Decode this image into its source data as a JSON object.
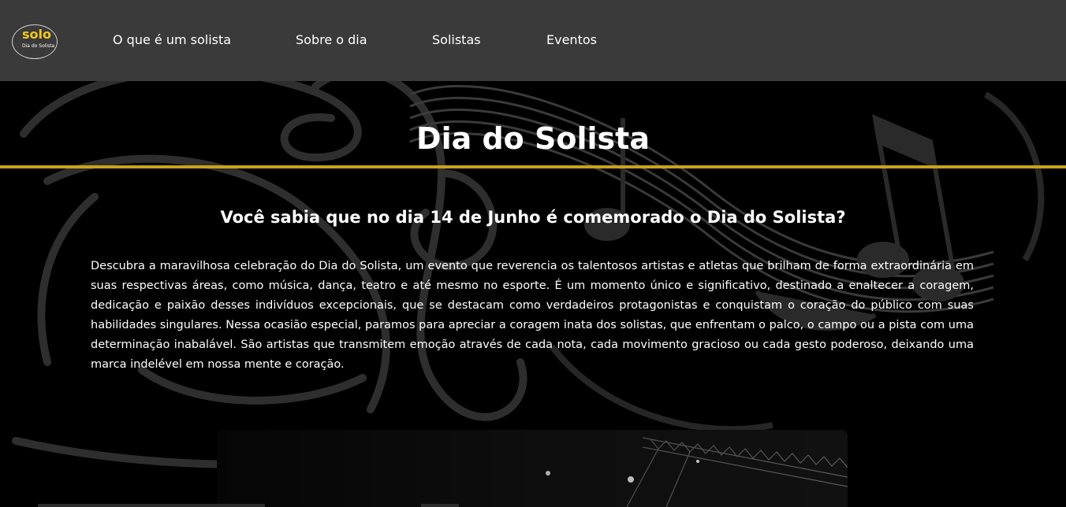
{
  "logo": {
    "word": "solo",
    "subtitle": "Dia do Solista"
  },
  "nav": {
    "items": [
      {
        "label": "O que é um solista"
      },
      {
        "label": "Sobre o dia"
      },
      {
        "label": "Solistas"
      },
      {
        "label": "Eventos"
      }
    ]
  },
  "hero": {
    "title": "Dia do Solista",
    "question": "Você sabia que no dia 14 de Junho é comemorado o Dia do Solista?",
    "paragraph": "Descubra a maravilhosa celebração do Dia do Solista, um evento que reverencia os talentosos artistas e atletas que brilham de forma extraordinária em suas respectivas áreas, como música, dança, teatro e até mesmo no esporte. É um momento único e significativo, destinado a enaltecer a coragem, dedicação e paixão desses indivíduos excepcionais, que se destacam como verdadeiros protagonistas e conquistam o coração do público com suas habilidades singulares. Nessa ocasião especial, paramos para apreciar a coragem inata dos solistas, que enfrentam o palco, o campo ou a pista com uma determinação inabalável. São artistas que transmitem emoção através de cada nota, cada movimento gracioso ou cada gesto poderoso, deixando uma marca indelével em nossa mente e coração."
  },
  "colors": {
    "navbar_bg": "#3a3a3a",
    "accent_gold": "#c9a318",
    "logo_yellow": "#f2c81b",
    "page_bg": "#000000"
  }
}
